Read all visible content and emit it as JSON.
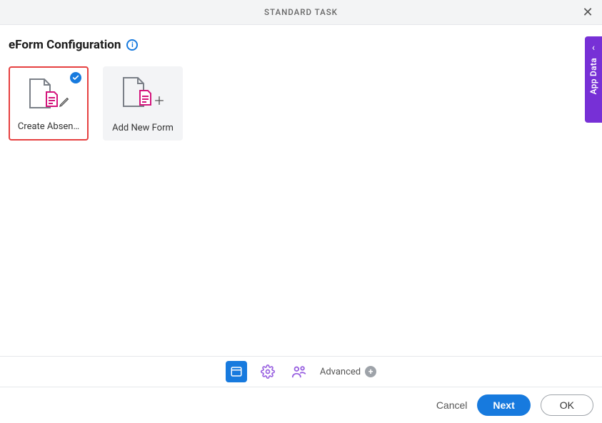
{
  "header": {
    "title": "STANDARD TASK"
  },
  "section": {
    "title": "eForm Configuration"
  },
  "cards": [
    {
      "label": "Create Absen…",
      "selected": true
    },
    {
      "label": "Add New Form",
      "selected": false
    }
  ],
  "sideTab": {
    "label": "App Data"
  },
  "toolbar": {
    "advanced_label": "Advanced"
  },
  "footer": {
    "cancel": "Cancel",
    "next": "Next",
    "ok": "OK"
  }
}
